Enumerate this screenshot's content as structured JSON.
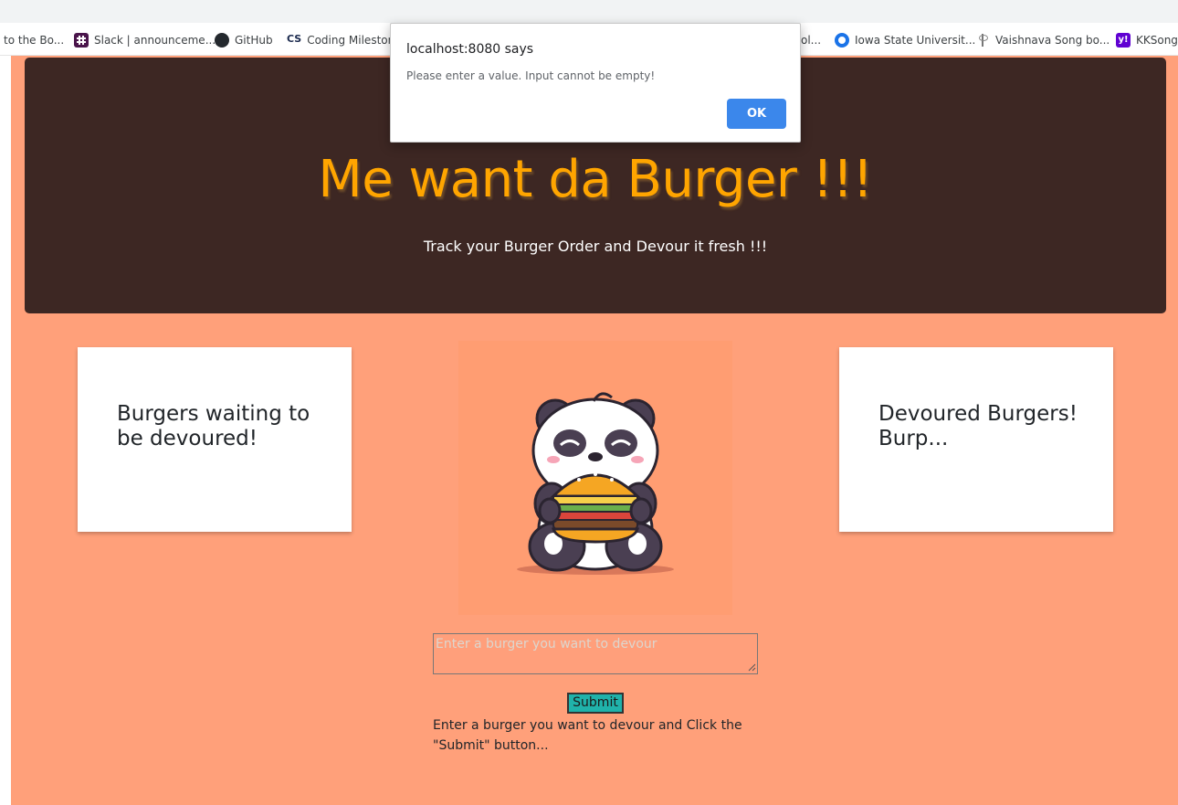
{
  "bookmarks": [
    {
      "label": "to the Bo...",
      "icon": "bookmark-icon"
    },
    {
      "label": "Slack | announceme...",
      "icon": "slack-icon"
    },
    {
      "label": "GitHub",
      "icon": "github-icon"
    },
    {
      "label": "Coding Milestone",
      "icon": "cs-icon",
      "icon_text": "CS"
    },
    {
      "label": "ol...",
      "icon": "bookmark-icon"
    },
    {
      "label": "Iowa State Universit...",
      "icon": "iowa-state-icon"
    },
    {
      "label": "Vaishnava Song bo...",
      "icon": "vaishnava-icon"
    },
    {
      "label": "KKSongs",
      "icon": "yahoo-icon",
      "icon_text": "y!"
    }
  ],
  "jumbotron": {
    "title": "Me want da Burger !!!",
    "subtitle": "Track your Burger Order and Devour it fresh !!!"
  },
  "cards": {
    "waiting_title": "Burgers waiting to be devoured!",
    "devoured_title": "Devoured Burgers! Burp..."
  },
  "mascot": {
    "icon": "panda-eating-burger-icon"
  },
  "form": {
    "placeholder": "Enter a burger you want to devour",
    "value": "",
    "submit_label": "Submit",
    "help_text": "Enter a burger you want to devour and Click the \"Submit\" button..."
  },
  "dialog": {
    "title": "localhost:8080 says",
    "message": "Please enter a value. Input cannot be empty!",
    "ok_label": "OK"
  },
  "colors": {
    "page_background": "#ffa07a",
    "jumbotron_background": "#3d2723",
    "title_color": "#ffa500",
    "submit_button": "#20b2aa",
    "dialog_ok": "#1a73e8"
  }
}
